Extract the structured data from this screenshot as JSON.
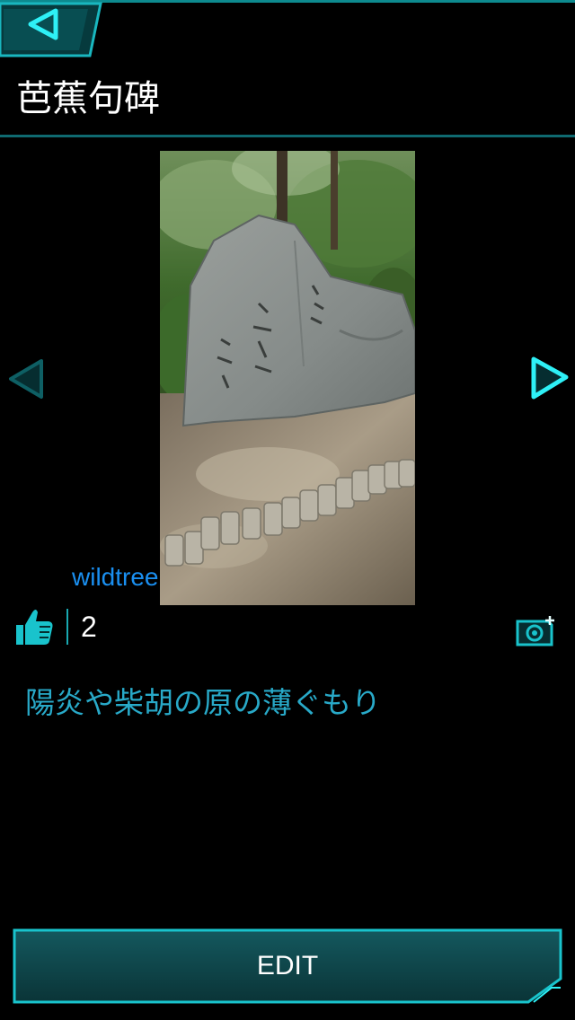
{
  "header": {
    "back_icon": "back-arrow-icon",
    "title": "芭蕉句碑"
  },
  "photo": {
    "description_icon": "stone-monument-photo",
    "prev_icon": "chevron-left-icon",
    "next_icon": "chevron-right-icon"
  },
  "meta": {
    "author": "wildtree",
    "like_icon": "thumbs-up-icon",
    "like_count": "2",
    "camera_icon": "add-photo-icon"
  },
  "body": {
    "haiku": "陽炎や柴胡の原の薄ぐもり"
  },
  "footer": {
    "edit_label": "EDIT"
  },
  "colors": {
    "accent": "#19d3dc",
    "accent_dark": "#0d6f74",
    "author_link": "#1a8ff0",
    "haiku_text": "#28a9c8",
    "background": "#000000"
  }
}
